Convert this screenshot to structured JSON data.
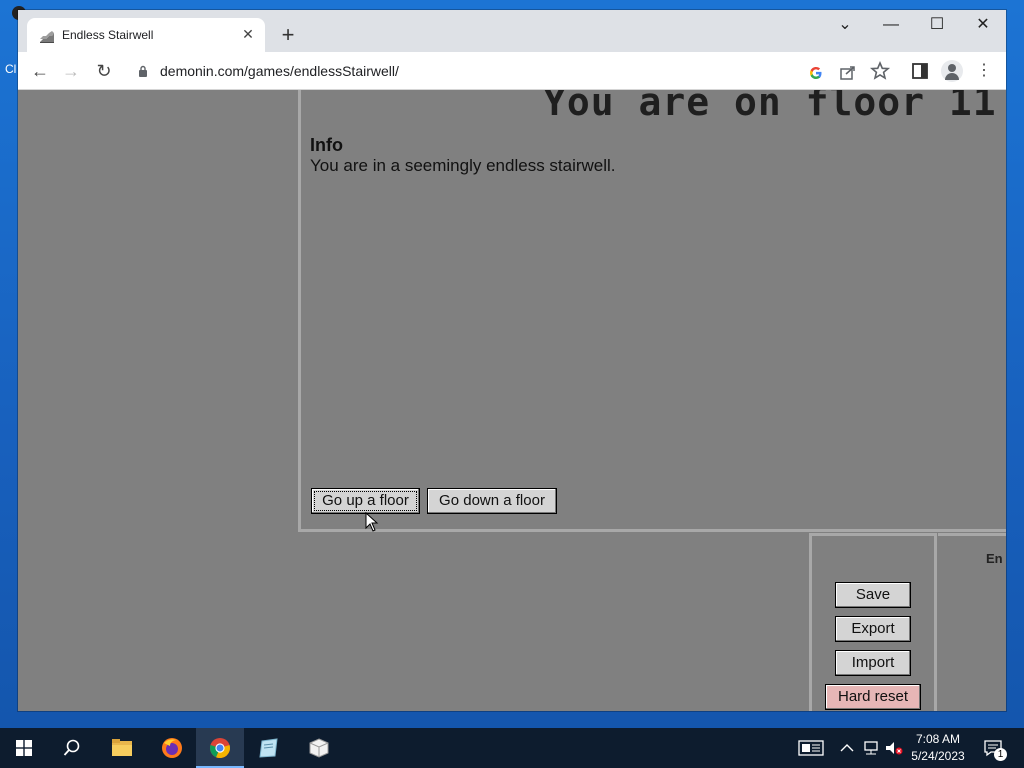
{
  "desktop": {
    "icon_label_fragment": "Cl"
  },
  "browser": {
    "tab": {
      "title": "Endless Stairwell",
      "close_glyph": "✕"
    },
    "new_tab_glyph": "+",
    "window_controls": {
      "collapse": "⌄",
      "minimize": "—",
      "maximize": "☐",
      "close": "✕"
    },
    "nav": {
      "back": "←",
      "forward": "→",
      "reload": "↻"
    },
    "omnibox": {
      "url": "demonin.com/games/endlessStairwell/"
    },
    "toolbar_icons": [
      "google-icon",
      "share-icon",
      "bookmark-star-icon",
      "side-panel-icon",
      "profile-icon",
      "menu-icon"
    ]
  },
  "game": {
    "floor_heading": "You are on floor 11",
    "info_heading": "Info",
    "info_text": "You are in a seemingly endless stairwell.",
    "buttons": {
      "up": "Go up a floor",
      "down": "Go down a floor",
      "save": "Save",
      "export": "Export",
      "import": "Import",
      "hard_reset": "Hard reset"
    },
    "right_panel_label": "En"
  },
  "taskbar": {
    "apps": [
      "start-icon",
      "search-icon",
      "file-explorer-icon",
      "firefox-icon",
      "chrome-icon",
      "notepad-icon",
      "package-icon"
    ],
    "time": "7:08 AM",
    "date": "5/24/2023",
    "notification_count": "1"
  },
  "colors": {
    "page_bg": "#808080",
    "panel_border": "#a8a8a8",
    "reset_bg": "#e6b6b6",
    "taskbar_bg": "#0d1c2e"
  }
}
